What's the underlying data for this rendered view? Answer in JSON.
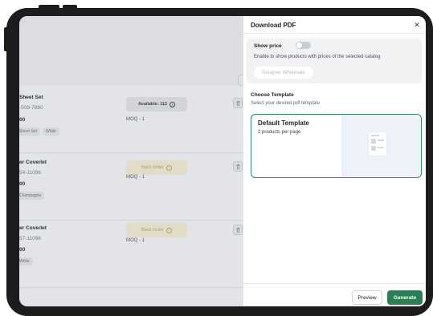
{
  "colors": {
    "accent_green": "#2c7f52",
    "overlay_grey": "#e2e4e8",
    "device_frame": "#1d1d1f"
  },
  "background_list": {
    "rows": [
      {
        "title": "Sheet Set",
        "sku": "-509-7880",
        "price": "00",
        "tags": [
          "Sheet Set",
          "White"
        ],
        "availability": "Available: 112",
        "availability_status": "available",
        "moq": "MOQ - 1"
      },
      {
        "title": "er Coverlet",
        "sku": "54-11096",
        "price": "00",
        "tags": [
          "Champagne"
        ],
        "availability": "Back Order",
        "availability_status": "backorder",
        "moq": "MOQ - 1"
      },
      {
        "title": "er Coverlet",
        "sku": "57-11096",
        "price": "00",
        "tags": [
          "White"
        ],
        "availability": "Back Order",
        "availability_status": "backorder",
        "moq": "MOQ - 1"
      }
    ]
  },
  "download_pdf": {
    "title": "Download PDF",
    "close_icon": "close-icon",
    "show_price": {
      "label": "Show price",
      "enabled": false,
      "description": "Enable to show products with prices of the selected catalog",
      "catalog": "Designer Wholesale"
    },
    "choose_template": {
      "title": "Choose Template",
      "subtitle": "Select your desired pdf template",
      "templates": [
        {
          "name": "Default Template",
          "description": "2 products per page",
          "selected": true
        }
      ]
    },
    "actions": {
      "preview": "Preview",
      "generate": "Generate"
    }
  }
}
